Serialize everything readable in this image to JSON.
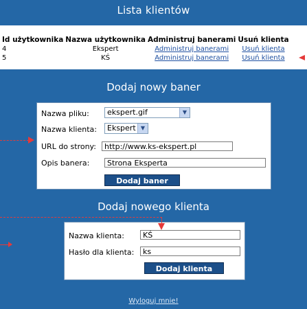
{
  "client_list": {
    "title": "Lista klientów",
    "headers": [
      "Id użytkownika",
      "Nazwa użytkownika",
      "Administruj banerami",
      "Usuń klienta"
    ],
    "rows": [
      {
        "id": "4",
        "name": "Ekspert",
        "admin_link": "Administruj banerami",
        "delete_link": "Usuń klienta"
      },
      {
        "id": "5",
        "name": "KŚ",
        "admin_link": "Administruj banerami",
        "delete_link": "Usuń klienta"
      }
    ]
  },
  "banner_form": {
    "title": "Dodaj nowy baner",
    "file_label": "Nazwa pliku:",
    "file_value": "ekspert.gif",
    "client_label": "Nazwa klienta:",
    "client_value": "Ekspert",
    "url_label": "URL do strony:",
    "url_value": "http://www.ks-ekspert.pl",
    "desc_label": "Opis banera:",
    "desc_value": "Strona Eksperta",
    "submit_label": "Dodaj baner"
  },
  "client_form": {
    "title": "Dodaj nowego klienta",
    "name_label": "Nazwa klienta:",
    "name_value": "KŚ",
    "password_label": "Hasło dla klienta:",
    "password_value": "ks",
    "submit_label": "Dodaj klienta"
  },
  "logout_label": "Wyloguj mnie!",
  "colors": {
    "background": "#2467a6",
    "button": "#1c4f89",
    "annotation_arrow": "#e53a3a"
  }
}
